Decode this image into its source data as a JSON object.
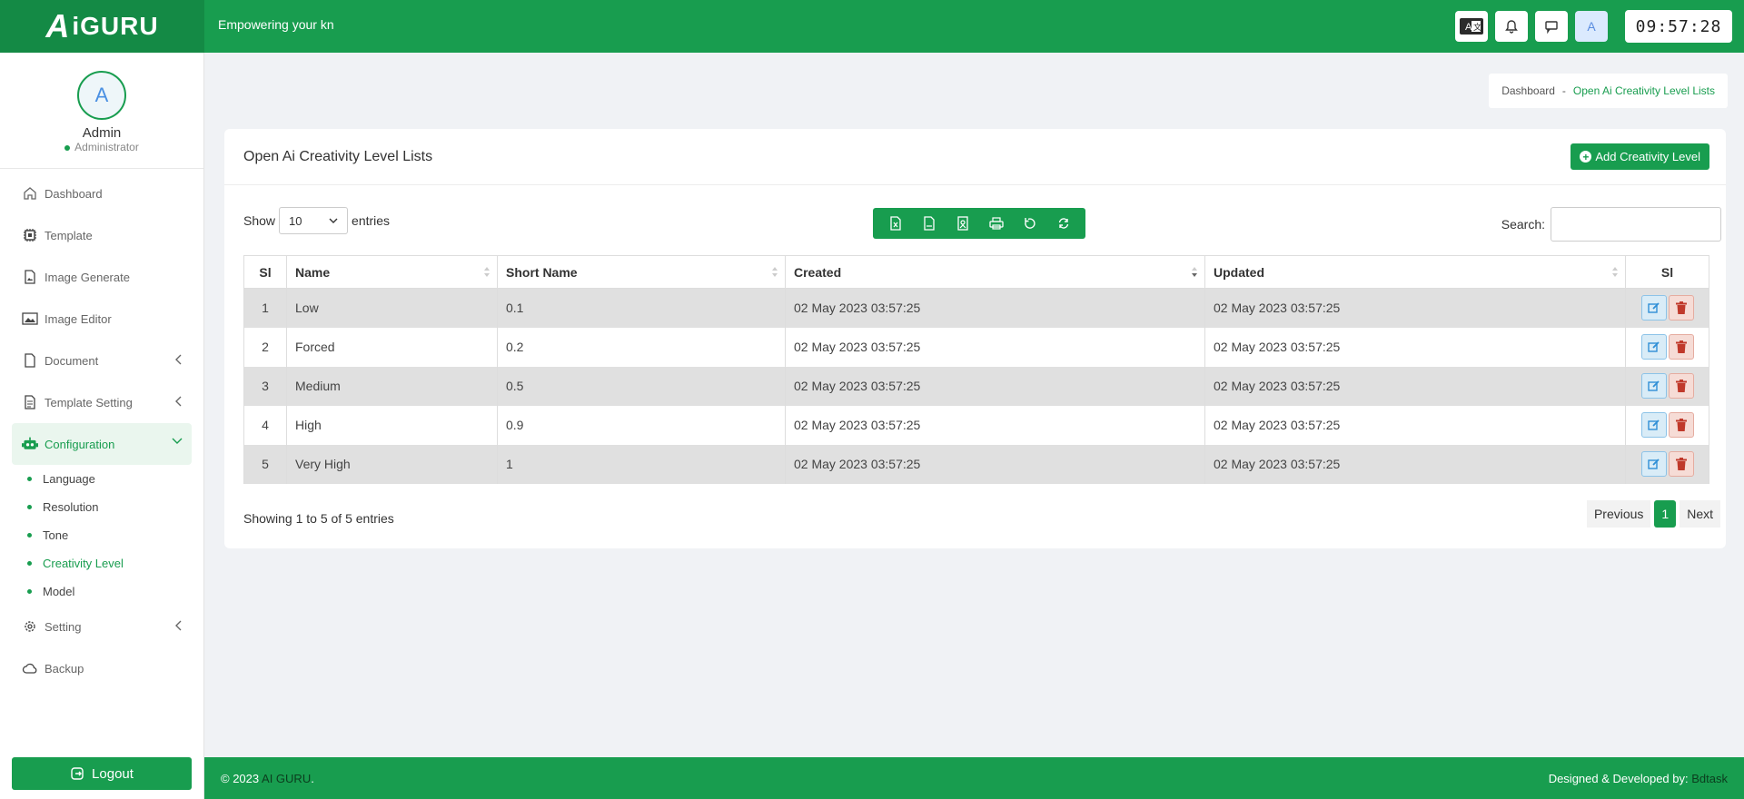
{
  "brand": {
    "logo_a": "A",
    "logo_rest": "iGURU",
    "tagline": "Empowering your kn"
  },
  "header": {
    "clock": "09:57:28",
    "avatar_letter": "A"
  },
  "profile": {
    "initial": "A",
    "name": "Admin",
    "role": "Administrator"
  },
  "sidebar": {
    "items": [
      {
        "label": "Dashboard"
      },
      {
        "label": "Template"
      },
      {
        "label": "Image Generate"
      },
      {
        "label": "Image Editor"
      },
      {
        "label": "Document"
      },
      {
        "label": "Template Setting"
      },
      {
        "label": "Configuration"
      },
      {
        "label": "Setting"
      },
      {
        "label": "Backup"
      }
    ],
    "subitems": [
      "Language",
      "Resolution",
      "Tone",
      "Creativity Level",
      "Model"
    ],
    "logout": "Logout"
  },
  "breadcrumb": {
    "home": "Dashboard",
    "separator": "-",
    "current": "Open Ai Creativity Level Lists"
  },
  "card": {
    "title": "Open Ai Creativity Level Lists",
    "add_label": "Add Creativity Level",
    "show_label": "Show",
    "entries_label": "entries",
    "page_size": "10",
    "search_label": "Search:",
    "search_value": ""
  },
  "table": {
    "columns": [
      "Sl",
      "Name",
      "Short Name",
      "Created",
      "Updated",
      "Sl"
    ],
    "rows": [
      {
        "sl": "1",
        "name": "Low",
        "short": "0.1",
        "created": "02 May 2023 03:57:25",
        "updated": "02 May 2023 03:57:25"
      },
      {
        "sl": "2",
        "name": "Forced",
        "short": "0.2",
        "created": "02 May 2023 03:57:25",
        "updated": "02 May 2023 03:57:25"
      },
      {
        "sl": "3",
        "name": "Medium",
        "short": "0.5",
        "created": "02 May 2023 03:57:25",
        "updated": "02 May 2023 03:57:25"
      },
      {
        "sl": "4",
        "name": "High",
        "short": "0.9",
        "created": "02 May 2023 03:57:25",
        "updated": "02 May 2023 03:57:25"
      },
      {
        "sl": "5",
        "name": "Very High",
        "short": "1",
        "created": "02 May 2023 03:57:25",
        "updated": "02 May 2023 03:57:25"
      }
    ]
  },
  "pagination": {
    "info": "Showing 1 to 5 of 5 entries",
    "previous": "Previous",
    "page": "1",
    "next": "Next"
  },
  "footer": {
    "copyright": "© 2023",
    "brand": "AI GURU",
    "period": ".",
    "credit": "Designed & Developed by:",
    "company": "Bdtask"
  },
  "colors": {
    "primary": "#189d4f",
    "edit": "#2f8fd6",
    "delete": "#c0392b"
  }
}
